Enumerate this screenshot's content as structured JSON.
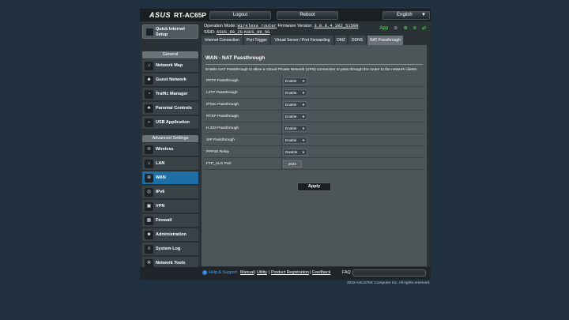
{
  "header": {
    "brand": "ASUS",
    "model": "RT-AC65P",
    "logout_label": "Logout",
    "reboot_label": "Reboot",
    "language": "English"
  },
  "status": {
    "op_mode_label": "Operation Mode:",
    "op_mode_value": "Wireless router",
    "firmware_label": "Firmware Version:",
    "firmware_value": "3.0.0.4.382_51599",
    "ssid_label": "SSID:",
    "ssid_2g": "ASUS_88_2G",
    "ssid_5g": "ASUS_88_5G",
    "app_label": "App"
  },
  "sidebar": {
    "quick_setup": "Quick Internet Setup",
    "general_header": "General",
    "general_items": [
      {
        "label": "Network Map",
        "icon": "network-map-icon"
      },
      {
        "label": "Guest Network",
        "icon": "guest-network-icon"
      },
      {
        "label": "Traffic Manager",
        "icon": "traffic-manager-icon"
      },
      {
        "label": "Parental Controls",
        "icon": "parental-controls-icon"
      },
      {
        "label": "USB Application",
        "icon": "usb-icon"
      }
    ],
    "advanced_header": "Advanced Settings",
    "advanced_items": [
      {
        "label": "Wireless",
        "icon": "wireless-icon"
      },
      {
        "label": "LAN",
        "icon": "lan-icon"
      },
      {
        "label": "WAN",
        "icon": "wan-icon",
        "active": true
      },
      {
        "label": "IPv6",
        "icon": "ipv6-icon"
      },
      {
        "label": "VPN",
        "icon": "vpn-icon"
      },
      {
        "label": "Firewall",
        "icon": "firewall-icon"
      },
      {
        "label": "Administration",
        "icon": "administration-icon"
      },
      {
        "label": "System Log",
        "icon": "system-log-icon"
      },
      {
        "label": "Network Tools",
        "icon": "network-tools-icon"
      }
    ]
  },
  "tabs": [
    {
      "label": "Internet Connection"
    },
    {
      "label": "Port Trigger"
    },
    {
      "label": "Virtual Server / Port Forwarding"
    },
    {
      "label": "DMZ"
    },
    {
      "label": "DDNS"
    },
    {
      "label": "NAT Passthrough",
      "active": true
    }
  ],
  "panel": {
    "title": "WAN - NAT Passthrough",
    "description": "Enable NAT Passthrough to allow a Virtual Private Network (VPN) connection to pass through the router to the network clients.",
    "settings": [
      {
        "label": "PPTP Passthrough",
        "value": "Enable"
      },
      {
        "label": "L2TP Passthrough",
        "value": "Enable"
      },
      {
        "label": "IPSec Passthrough",
        "value": "Enable"
      },
      {
        "label": "RTSP Passthrough",
        "value": "Enable"
      },
      {
        "label": "H.323 Passthrough",
        "value": "Enable"
      },
      {
        "label": "SIP Passthrough",
        "value": "Enable"
      },
      {
        "label": "PPPoE Relay",
        "value": "Disable"
      },
      {
        "label": "FTP_ALG Port",
        "value": "2021"
      }
    ],
    "apply_label": "Apply"
  },
  "footer": {
    "help_label": "Help & Support",
    "links": [
      "Manual",
      "Utility",
      "Product Registration",
      "Feedback"
    ],
    "separator": "|",
    "faq_label": "FAQ",
    "copyright": "2019 ASUSTeK Computer Inc. All rights reserved."
  },
  "colors": {
    "background": "#213040",
    "active_nav": "#1f6fa7",
    "panel": "#4c5558",
    "status_green": "#5ce65c"
  }
}
